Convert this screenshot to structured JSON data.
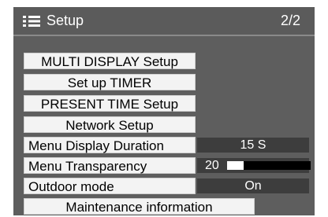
{
  "header": {
    "title": "Setup",
    "page_indicator": "2/2",
    "icon": "menu-list-icon"
  },
  "menu_items": [
    {
      "label": "MULTI DISPLAY Setup"
    },
    {
      "label": "Set up TIMER"
    },
    {
      "label": "PRESENT TIME Setup"
    },
    {
      "label": "Network Setup"
    }
  ],
  "settings": {
    "menu_display_duration": {
      "label": "Menu Display Duration",
      "value": "15 S"
    },
    "menu_transparency": {
      "label": "Menu Transparency",
      "value": "20",
      "level_percent": 20
    },
    "outdoor_mode": {
      "label": "Outdoor mode",
      "value": "On"
    }
  },
  "maintenance": {
    "label": "Maintenance information"
  },
  "colors": {
    "panel_bg": "#5e5e5e",
    "button_bg": "#f3f3f3",
    "value_bg": "#3d3d3d",
    "text_light": "#ffffff"
  }
}
